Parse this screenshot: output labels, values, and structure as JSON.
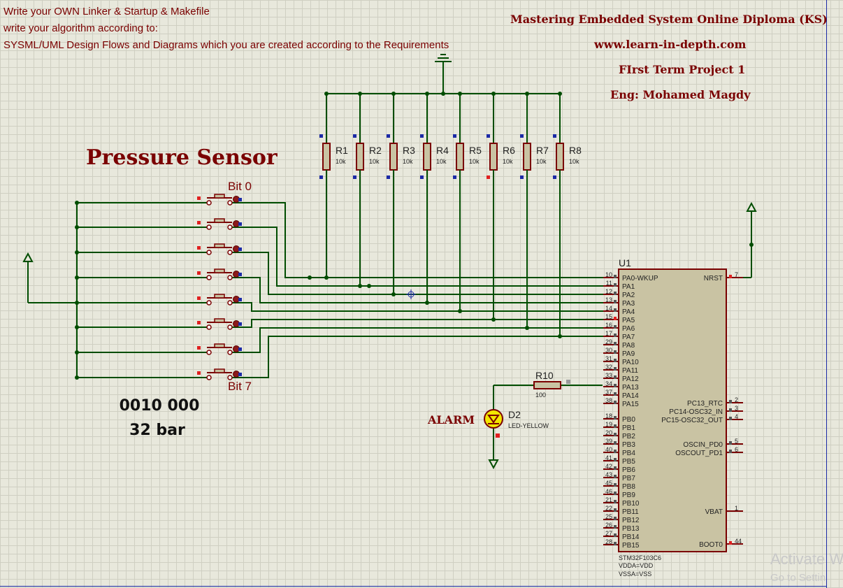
{
  "task_text": [
    "Write your OWN Linker & Startup & Makefile",
    "write your algorithm according to:",
    "SYSML/UML  Design Flows and Diagrams which you are created according to the Requirements"
  ],
  "header": {
    "course": "Mastering Embedded System Online Diploma (KS)",
    "website": "www.learn-in-depth.com",
    "project": "FIrst Term Project 1",
    "engineer": "Eng:  Mohamed Magdy"
  },
  "sensor": {
    "title": "Pressure Sensor",
    "bit_first": "Bit 0",
    "bit_last": "Bit 7",
    "reading_binary": "0010 000",
    "reading_value": "32 bar"
  },
  "resistors": [
    {
      "name": "R1",
      "value": "10k"
    },
    {
      "name": "R2",
      "value": "10k"
    },
    {
      "name": "R3",
      "value": "10k"
    },
    {
      "name": "R4",
      "value": "10k"
    },
    {
      "name": "R5",
      "value": "10k"
    },
    {
      "name": "R6",
      "value": "10k"
    },
    {
      "name": "R7",
      "value": "10k"
    },
    {
      "name": "R8",
      "value": "10k"
    }
  ],
  "alarm": {
    "label": "ALARM",
    "led_name": "D2",
    "led_type": "LED-YELLOW",
    "resistor_name": "R10",
    "resistor_value": "100"
  },
  "mcu": {
    "ref": "U1",
    "part": "STM32F103C6",
    "notes": [
      "VDDA=VDD",
      "VSSA=VSS"
    ],
    "left_pins": [
      {
        "num": "10",
        "name": "PA0-WKUP"
      },
      {
        "num": "11",
        "name": "PA1"
      },
      {
        "num": "12",
        "name": "PA2"
      },
      {
        "num": "13",
        "name": "PA3"
      },
      {
        "num": "14",
        "name": "PA4"
      },
      {
        "num": "15",
        "name": "PA5"
      },
      {
        "num": "16",
        "name": "PA6"
      },
      {
        "num": "17",
        "name": "PA7"
      },
      {
        "num": "29",
        "name": "PA8"
      },
      {
        "num": "30",
        "name": "PA9"
      },
      {
        "num": "31",
        "name": "PA10"
      },
      {
        "num": "32",
        "name": "PA11"
      },
      {
        "num": "33",
        "name": "PA12"
      },
      {
        "num": "34",
        "name": "PA13"
      },
      {
        "num": "37",
        "name": "PA14"
      },
      {
        "num": "38",
        "name": "PA15"
      },
      {
        "num": "18",
        "name": "PB0"
      },
      {
        "num": "19",
        "name": "PB1"
      },
      {
        "num": "20",
        "name": "PB2"
      },
      {
        "num": "39",
        "name": "PB3"
      },
      {
        "num": "40",
        "name": "PB4"
      },
      {
        "num": "41",
        "name": "PB5"
      },
      {
        "num": "42",
        "name": "PB6"
      },
      {
        "num": "43",
        "name": "PB7"
      },
      {
        "num": "45",
        "name": "PB8"
      },
      {
        "num": "46",
        "name": "PB9"
      },
      {
        "num": "21",
        "name": "PB10"
      },
      {
        "num": "22",
        "name": "PB11"
      },
      {
        "num": "25",
        "name": "PB12"
      },
      {
        "num": "26",
        "name": "PB13"
      },
      {
        "num": "27",
        "name": "PB14"
      },
      {
        "num": "28",
        "name": "PB15"
      }
    ],
    "right_pins": [
      {
        "num": "7",
        "name": "NRST"
      },
      {
        "num": "2",
        "name": "PC13_RTC"
      },
      {
        "num": "3",
        "name": "PC14-OSC32_IN"
      },
      {
        "num": "4",
        "name": "PC15-OSC32_OUT"
      },
      {
        "num": "5",
        "name": "OSCIN_PD0"
      },
      {
        "num": "6",
        "name": "OSCOUT_PD1"
      },
      {
        "num": "1",
        "name": "VBAT"
      },
      {
        "num": "44",
        "name": "BOOT0"
      }
    ]
  },
  "watermark": {
    "line1": "Activate W",
    "line2": "Go to Settin"
  },
  "colors": {
    "wire": "#004d00",
    "component_fill": "#c9c3a3",
    "component_outline": "#7a0000",
    "label": "#7a0000",
    "pin_blue": "#1c2aa6",
    "pin_red": "#e02020"
  }
}
